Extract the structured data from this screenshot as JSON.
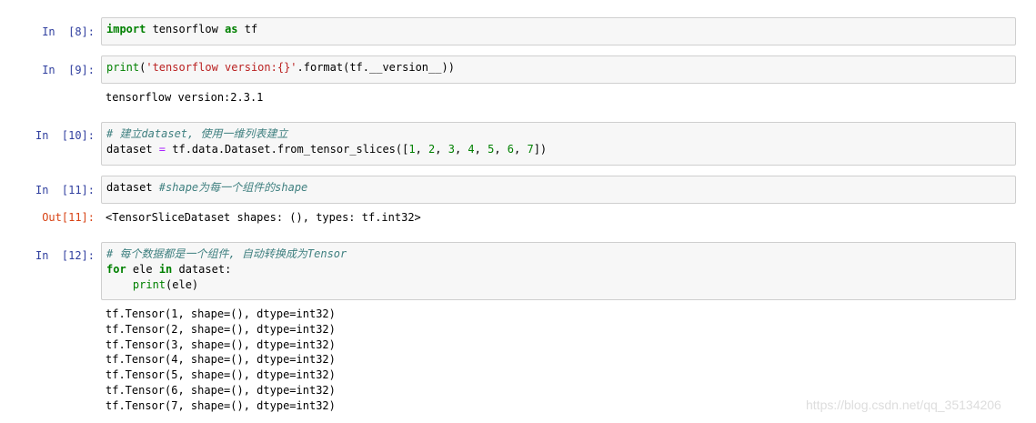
{
  "cells": [
    {
      "prompt": "In  [8]:",
      "lines": [
        [
          {
            "t": "import",
            "c": "kw"
          },
          {
            "t": " tensorflow "
          },
          {
            "t": "as",
            "c": "kw"
          },
          {
            "t": " tf"
          }
        ]
      ]
    },
    {
      "prompt": "In  [9]:",
      "lines": [
        [
          {
            "t": "print",
            "c": "bi"
          },
          {
            "t": "("
          },
          {
            "t": "'tensorflow version:{}'",
            "c": "str"
          },
          {
            "t": ".format(tf.__version__))"
          }
        ]
      ],
      "output": [
        "tensorflow version:2.3.1"
      ]
    },
    {
      "prompt": "In  [10]:",
      "lines": [
        [
          {
            "t": "# 建立dataset, 使用一维列表建立",
            "c": "cm"
          }
        ],
        [
          {
            "t": "dataset "
          },
          {
            "t": "=",
            "c": "op"
          },
          {
            "t": " tf.data.Dataset.from_tensor_slices(["
          },
          {
            "t": "1",
            "c": "num"
          },
          {
            "t": ", "
          },
          {
            "t": "2",
            "c": "num"
          },
          {
            "t": ", "
          },
          {
            "t": "3",
            "c": "num"
          },
          {
            "t": ", "
          },
          {
            "t": "4",
            "c": "num"
          },
          {
            "t": ", "
          },
          {
            "t": "5",
            "c": "num"
          },
          {
            "t": ", "
          },
          {
            "t": "6",
            "c": "num"
          },
          {
            "t": ", "
          },
          {
            "t": "7",
            "c": "num"
          },
          {
            "t": "])"
          }
        ]
      ]
    },
    {
      "prompt": "In  [11]:",
      "lines": [
        [
          {
            "t": "dataset "
          },
          {
            "t": "#shape为每一个组件的shape",
            "c": "cm"
          }
        ]
      ],
      "out_prompt": "Out[11]:",
      "output": [
        "<TensorSliceDataset shapes: (), types: tf.int32>"
      ]
    },
    {
      "prompt": "In  [12]:",
      "lines": [
        [
          {
            "t": "# 每个数据都是一个组件, 自动转换成为Tensor",
            "c": "cm"
          }
        ],
        [
          {
            "t": "for",
            "c": "kw"
          },
          {
            "t": " ele "
          },
          {
            "t": "in",
            "c": "kw"
          },
          {
            "t": " dataset:"
          }
        ],
        [
          {
            "t": "    "
          },
          {
            "t": "print",
            "c": "bi"
          },
          {
            "t": "(ele)"
          }
        ]
      ],
      "output": [
        "tf.Tensor(1, shape=(), dtype=int32)",
        "tf.Tensor(2, shape=(), dtype=int32)",
        "tf.Tensor(3, shape=(), dtype=int32)",
        "tf.Tensor(4, shape=(), dtype=int32)",
        "tf.Tensor(5, shape=(), dtype=int32)",
        "tf.Tensor(6, shape=(), dtype=int32)",
        "tf.Tensor(7, shape=(), dtype=int32)"
      ]
    }
  ],
  "watermark": "https://blog.csdn.net/qq_35134206"
}
